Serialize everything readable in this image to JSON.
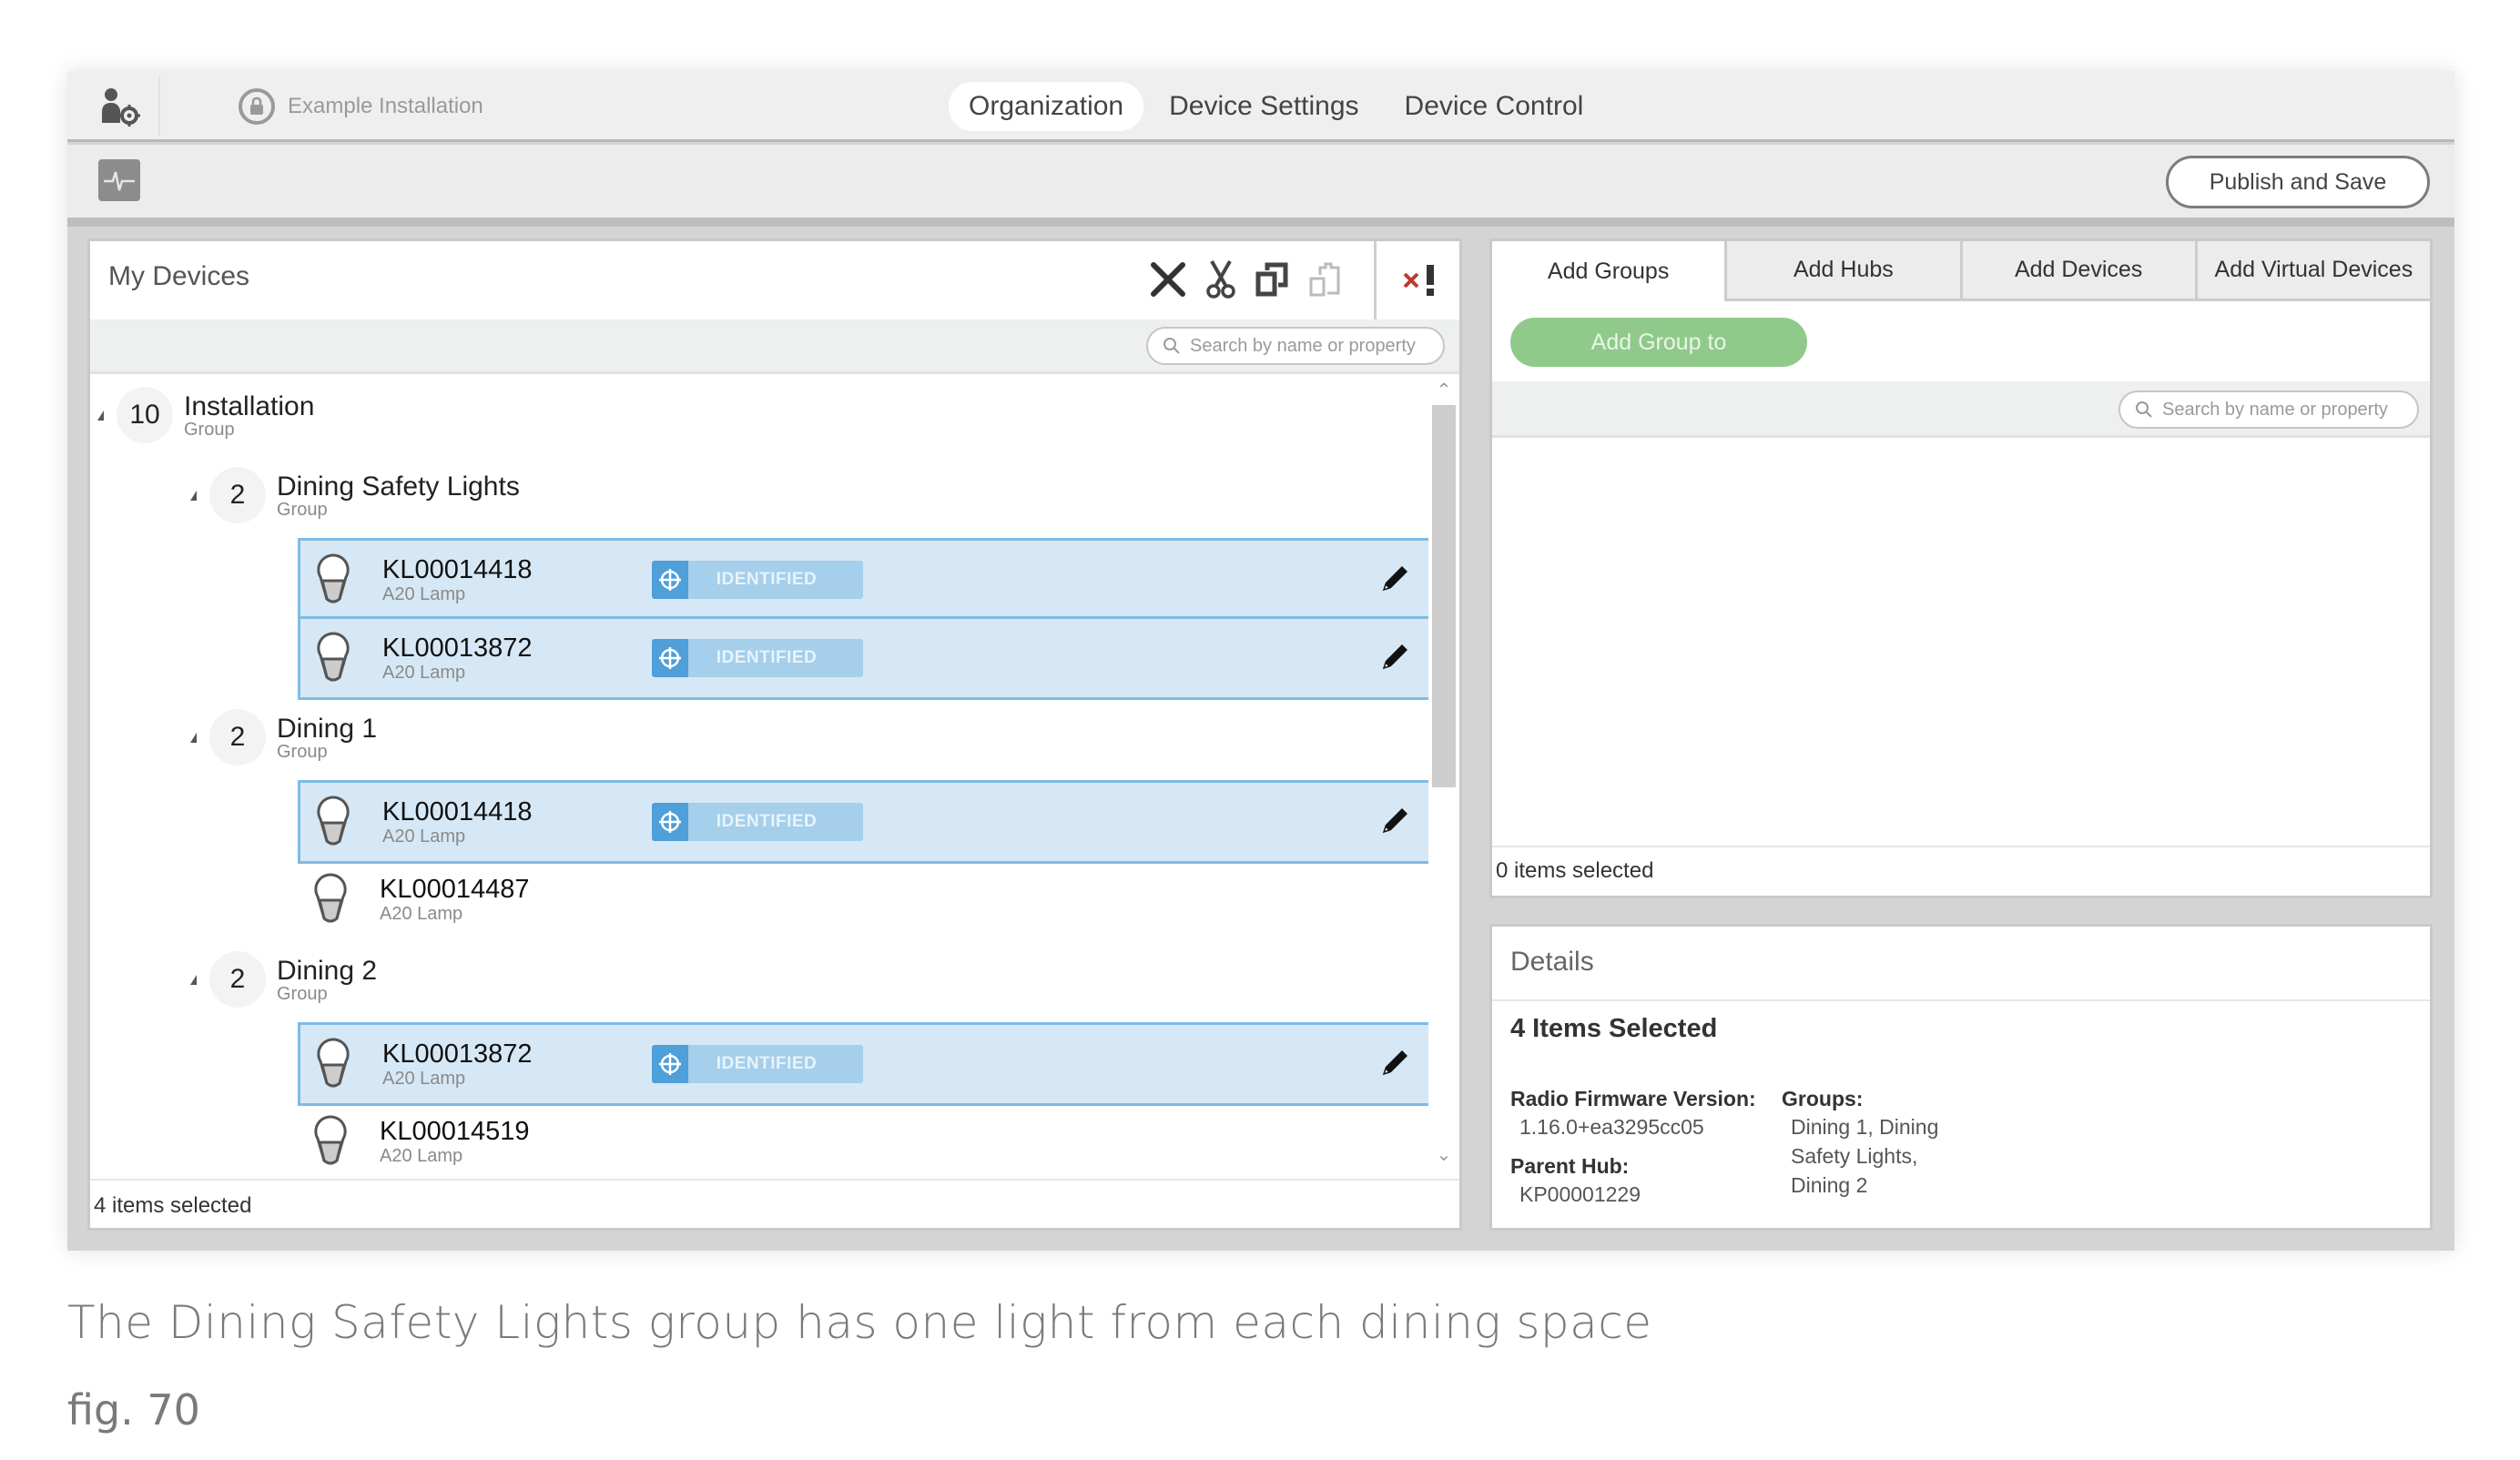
{
  "topbar": {
    "installation_name": "Example Installation",
    "nav_tabs": [
      {
        "label": "Organization",
        "active": true
      },
      {
        "label": "Device Settings",
        "active": false
      },
      {
        "label": "Device Control",
        "active": false
      }
    ]
  },
  "toolbar": {
    "publish_label": "Publish and Save"
  },
  "my_devices": {
    "title": "My Devices",
    "tools": [
      "delete-icon",
      "cut-icon",
      "copy-icon",
      "paste-icon",
      "clear-errors-icon"
    ],
    "search_placeholder": "Search by name or property",
    "root": {
      "count": "10",
      "name": "Installation",
      "type": "Group"
    },
    "groups": [
      {
        "count": "2",
        "name": "Dining Safety Lights",
        "type": "Group",
        "devices": [
          {
            "id": "KL00014418",
            "type": "A20 Lamp",
            "selected": true,
            "status": "IDENTIFIED"
          },
          {
            "id": "KL00013872",
            "type": "A20 Lamp",
            "selected": true,
            "status": "IDENTIFIED"
          }
        ]
      },
      {
        "count": "2",
        "name": "Dining 1",
        "type": "Group",
        "devices": [
          {
            "id": "KL00014418",
            "type": "A20 Lamp",
            "selected": true,
            "status": "IDENTIFIED"
          },
          {
            "id": "KL00014487",
            "type": "A20 Lamp",
            "selected": false,
            "status": ""
          }
        ]
      },
      {
        "count": "2",
        "name": "Dining 2",
        "type": "Group",
        "devices": [
          {
            "id": "KL00013872",
            "type": "A20 Lamp",
            "selected": true,
            "status": "IDENTIFIED"
          },
          {
            "id": "KL00014519",
            "type": "A20 Lamp",
            "selected": false,
            "status": ""
          }
        ]
      }
    ],
    "footer": "4 items selected"
  },
  "add_panel": {
    "tabs": [
      {
        "label": "Add Groups",
        "active": true
      },
      {
        "label": "Add Hubs",
        "active": false
      },
      {
        "label": "Add Devices",
        "active": false
      },
      {
        "label": "Add Virtual Devices",
        "active": false
      }
    ],
    "add_group_button": "Add Group to",
    "search_placeholder": "Search by name or property",
    "footer": "0 items selected"
  },
  "details": {
    "title": "Details",
    "selection": "4 Items Selected",
    "radio_firmware_label": "Radio Firmware Version:",
    "radio_firmware_value": "1.16.0+ea3295cc05",
    "parent_hub_label": "Parent Hub:",
    "parent_hub_value": "KP00001229",
    "groups_label": "Groups:",
    "groups_value_lines": [
      "Dining 1, Dining",
      "Safety Lights,",
      "Dining 2"
    ]
  },
  "caption": "The Dining Safety Lights group has one light from each dining space",
  "figure_label": "fig. 70",
  "colors": {
    "selected_row_bg": "#d6e8f5",
    "selected_row_border": "#7fbbe3",
    "identified_badge": "#a5cfea",
    "add_group_green": "#8fca8a",
    "clear_errors_red": "#c0392b"
  }
}
